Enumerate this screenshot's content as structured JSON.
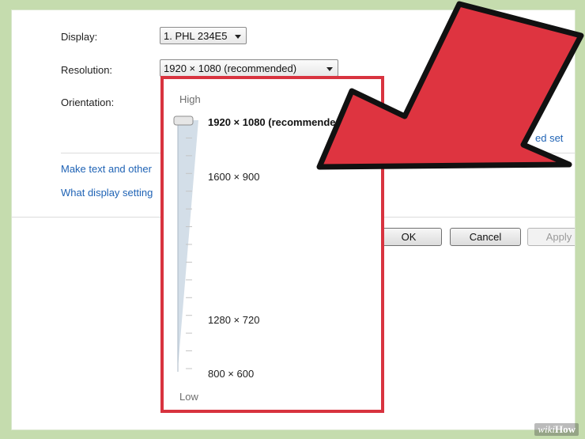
{
  "settings": {
    "display": {
      "label": "Display:",
      "value": "1. PHL 234E5"
    },
    "resolution": {
      "label": "Resolution:",
      "value": "1920 × 1080 (recommended)"
    },
    "orientation": {
      "label": "Orientation:"
    },
    "advanced_link_fragment": "ed set",
    "link_text_size": "Make text and other",
    "link_display_settings": "What display setting"
  },
  "buttons": {
    "ok": "OK",
    "cancel": "Cancel",
    "apply": "Apply"
  },
  "resolution_slider": {
    "high_label": "High",
    "low_label": "Low",
    "selected": "1920 × 1080 (recommended)",
    "options": [
      "1920 × 1080 (recommende",
      "1600 × 900",
      "1280 × 720",
      "800 × 600"
    ],
    "selected_level": 1.0
  },
  "colors": {
    "highlight_border": "#d8333f",
    "arrow_fill": "#de3440",
    "arrow_outline": "#111111",
    "link": "#1f63b5"
  },
  "watermark": {
    "prefix": "wiki",
    "suffix": "How"
  }
}
